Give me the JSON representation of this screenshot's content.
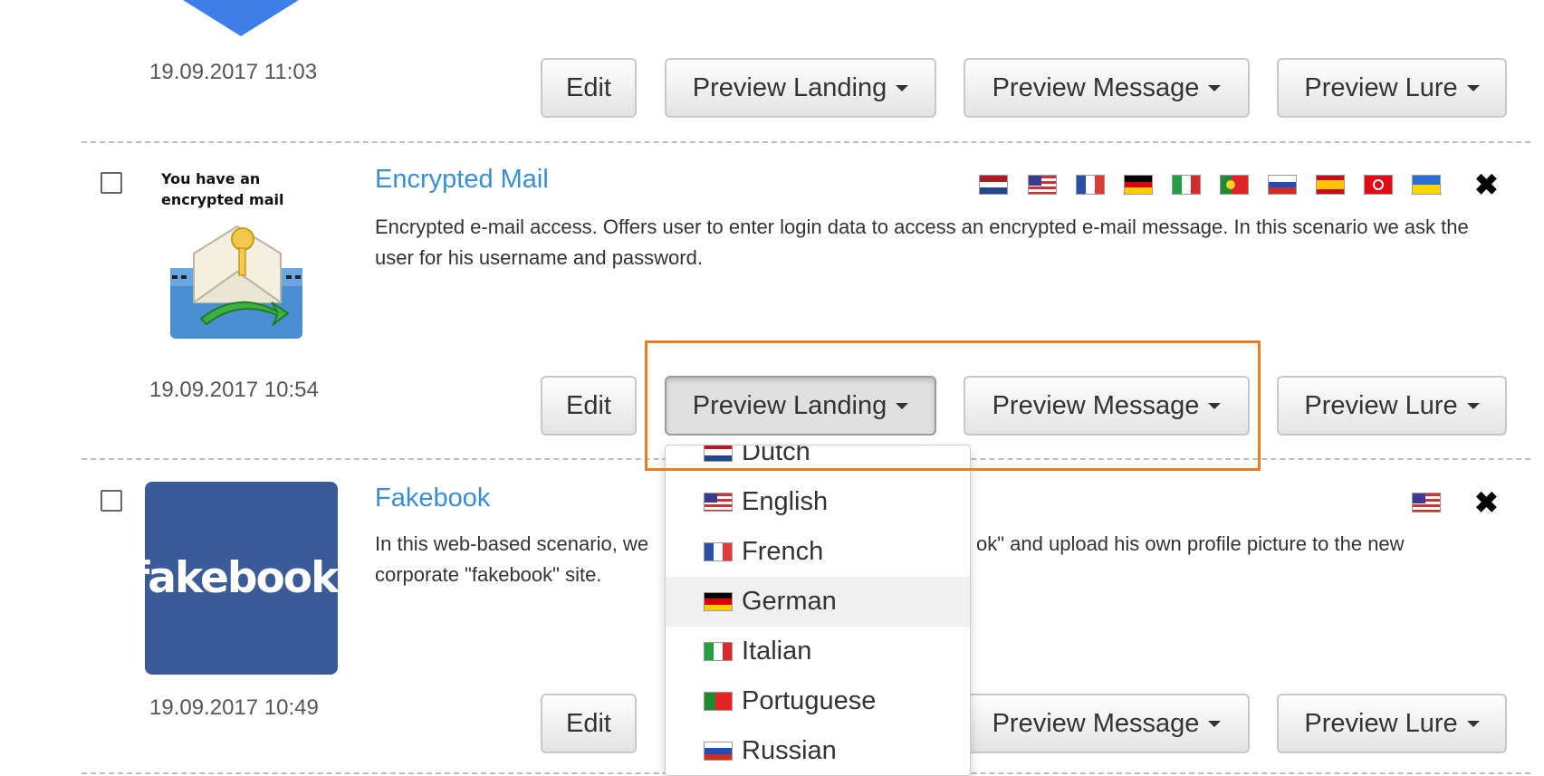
{
  "rows": [
    {
      "date": "19.09.2017 11:03",
      "buttons": {
        "edit": "Edit",
        "preview_landing": "Preview Landing",
        "preview_message": "Preview Message",
        "preview_lure": "Preview Lure"
      }
    },
    {
      "title": "Encrypted Mail",
      "description": "Encrypted e-mail access. Offers user to enter login data to access an encrypted e-mail message. In this scenario we ask the user for his username and password.",
      "thumbnail_text": [
        "You have an",
        "encrypted mail"
      ],
      "date": "19.09.2017 10:54",
      "flags": [
        "nl-flag-icon",
        "us-flag-icon",
        "fr-flag-icon",
        "de-flag-icon",
        "it-flag-icon",
        "pt-flag-icon",
        "ru-flag-icon",
        "es-flag-icon",
        "tr-flag-icon",
        "ua-flag-icon"
      ],
      "buttons": {
        "edit": "Edit",
        "preview_landing": "Preview Landing",
        "preview_message": "Preview Message",
        "preview_lure": "Preview Lure"
      }
    },
    {
      "title": "Fakebook",
      "description_left": "In this web-based scenario, we",
      "description_right": "ok\" and upload his own profile picture to the new",
      "description_line2": "corporate \"fakebook\" site.",
      "thumbnail_text": "fakebook.",
      "date": "19.09.2017 10:49",
      "flags": [
        "us-flag-icon"
      ],
      "buttons": {
        "edit": "Edit",
        "preview_message": "Preview Message",
        "preview_lure": "Preview Lure"
      }
    }
  ],
  "dropdown": {
    "items": [
      "Dutch",
      "English",
      "French",
      "German",
      "Italian",
      "Portuguese",
      "Russian"
    ],
    "highlighted": "German"
  },
  "colors": {
    "link": "#3b8fd0",
    "highlight_box": "#f07a1e",
    "fakebook_bg": "#3b5a9a"
  }
}
